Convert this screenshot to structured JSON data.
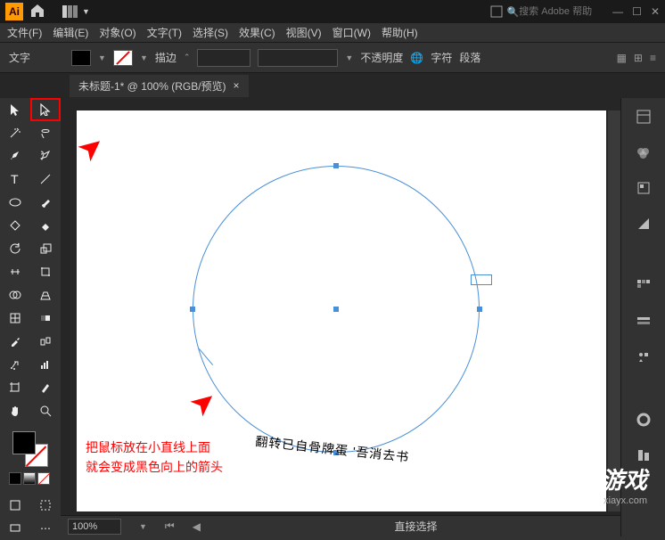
{
  "titlebar": {
    "logo_text": "Ai",
    "search_placeholder": "搜索 Adobe 帮助"
  },
  "menubar": {
    "file": "文件(F)",
    "edit": "编辑(E)",
    "object": "对象(O)",
    "type": "文字(T)",
    "select": "选择(S)",
    "effect": "效果(C)",
    "view": "视图(V)",
    "window": "窗口(W)",
    "help": "帮助(H)"
  },
  "controlbar": {
    "type_label": "文字",
    "stroke_label": "描边",
    "stroke_val": "",
    "opacity_label": "不透明度",
    "char_label": "字符",
    "para_label": "段落"
  },
  "doctab": {
    "title": "未标题-1* @ 100% (RGB/预览)",
    "close": "×"
  },
  "canvas": {
    "path_text": "翻转已自骨牌蛋 '吾消去书"
  },
  "annotation": {
    "line1": "把鼠标放在小直线上面",
    "line2": "就会变成黑色向上的箭头"
  },
  "watermark": {
    "logo": "侠 游戏",
    "url": "xiayx.com"
  },
  "statusbar": {
    "zoom": "100%",
    "tool_name": "直接选择"
  }
}
